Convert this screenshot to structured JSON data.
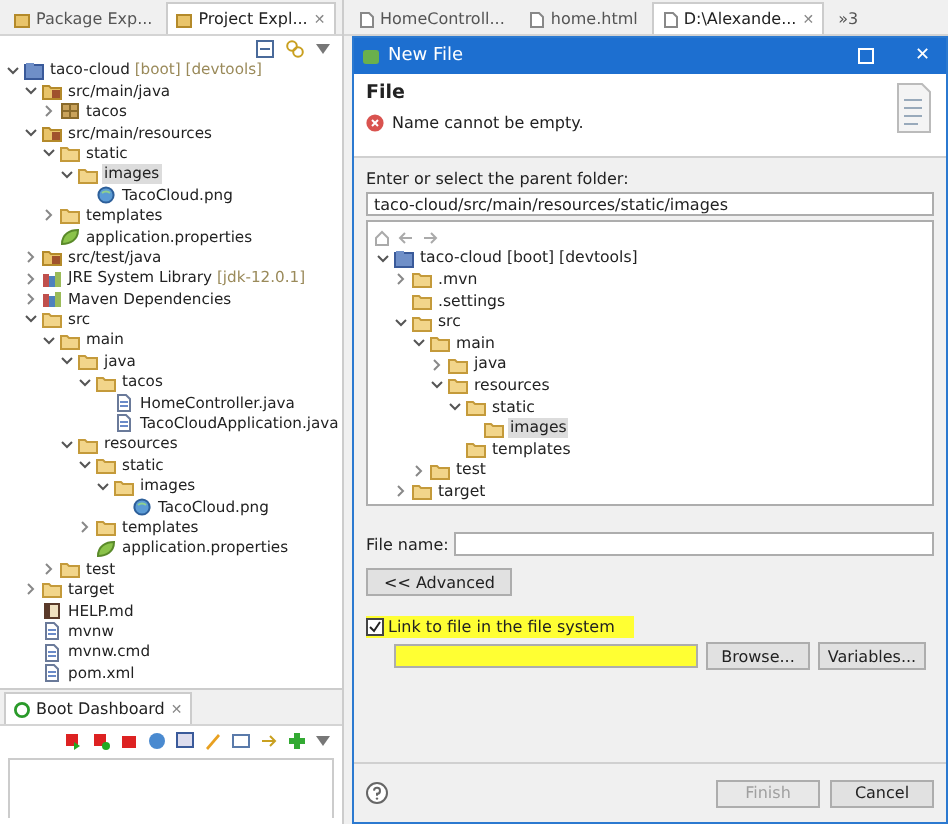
{
  "explorer": {
    "tabs": [
      {
        "label": "Package Exp...",
        "selected": false
      },
      {
        "label": "Project Expl...",
        "selected": true,
        "close": "✕"
      }
    ],
    "tree": [
      {
        "label": "taco-cloud",
        "decoration": "[boot] [devtools]",
        "kind": "project",
        "expanded": true,
        "selected": false,
        "children": [
          {
            "label": "src/main/java",
            "kind": "source",
            "expanded": true,
            "selected": false,
            "children": [
              {
                "label": "tacos",
                "kind": "package",
                "expanded": false,
                "selected": false
              }
            ]
          },
          {
            "label": "src/main/resources",
            "kind": "source",
            "expanded": true,
            "selected": false,
            "children": [
              {
                "label": "static",
                "kind": "folder",
                "expanded": true,
                "selected": false,
                "children": [
                  {
                    "label": "images",
                    "kind": "folder",
                    "expanded": true,
                    "selected": true,
                    "children": [
                      {
                        "label": "TacoCloud.png",
                        "kind": "image",
                        "selected": false
                      }
                    ]
                  }
                ]
              },
              {
                "label": "templates",
                "kind": "folder",
                "expanded": false,
                "selected": false
              },
              {
                "label": "application.properties",
                "kind": "leaf",
                "selected": false
              }
            ]
          },
          {
            "label": "src/test/java",
            "kind": "source",
            "expanded": false,
            "selected": false
          },
          {
            "label": "JRE System Library",
            "decoration": "[jdk-12.0.1]",
            "kind": "library",
            "expanded": false,
            "selected": false
          },
          {
            "label": "Maven Dependencies",
            "kind": "library",
            "expanded": false,
            "selected": false
          },
          {
            "label": "src",
            "kind": "folder",
            "expanded": true,
            "selected": false,
            "children": [
              {
                "label": "main",
                "kind": "folder",
                "expanded": true,
                "selected": false,
                "children": [
                  {
                    "label": "java",
                    "kind": "folder",
                    "expanded": true,
                    "selected": false,
                    "children": [
                      {
                        "label": "tacos",
                        "kind": "folder",
                        "expanded": true,
                        "selected": false,
                        "children": [
                          {
                            "label": "HomeController.java",
                            "kind": "file",
                            "selected": false
                          },
                          {
                            "label": "TacoCloudApplication.java",
                            "kind": "file",
                            "selected": false
                          }
                        ]
                      }
                    ]
                  },
                  {
                    "label": "resources",
                    "kind": "folder",
                    "expanded": true,
                    "selected": false,
                    "children": [
                      {
                        "label": "static",
                        "kind": "folder",
                        "expanded": true,
                        "selected": false,
                        "children": [
                          {
                            "label": "images",
                            "kind": "folder",
                            "expanded": true,
                            "selected": false,
                            "children": [
                              {
                                "label": "TacoCloud.png",
                                "kind": "image",
                                "selected": false
                              }
                            ]
                          }
                        ]
                      },
                      {
                        "label": "templates",
                        "kind": "folder",
                        "expanded": false,
                        "selected": false
                      },
                      {
                        "label": "application.properties",
                        "kind": "leaf",
                        "selected": false
                      }
                    ]
                  }
                ]
              },
              {
                "label": "test",
                "kind": "folder",
                "expanded": false,
                "selected": false
              }
            ]
          },
          {
            "label": "target",
            "kind": "folder",
            "expanded": false,
            "selected": false
          },
          {
            "label": "HELP.md",
            "kind": "book",
            "selected": false
          },
          {
            "label": "mvnw",
            "kind": "file",
            "selected": false
          },
          {
            "label": "mvnw.cmd",
            "kind": "file",
            "selected": false
          },
          {
            "label": "pom.xml",
            "kind": "file",
            "selected": false
          }
        ]
      }
    ]
  },
  "boot_dashboard": {
    "title": "Boot Dashboard",
    "close": "✕"
  },
  "editor_tabs": [
    {
      "label": "HomeControll...",
      "selected": false
    },
    {
      "label": "home.html",
      "selected": false
    },
    {
      "label": "D:\\Alexande...",
      "selected": true,
      "close": "✕"
    }
  ],
  "editor_overflow": "»3",
  "dialog": {
    "title": "New File",
    "close": "✕",
    "heading": "File",
    "error": "Name cannot be empty.",
    "folder_label": "Enter or select the parent folder:",
    "folder_value": "taco-cloud/src/main/resources/static/images",
    "tree": [
      {
        "label": "taco-cloud [boot] [devtools]",
        "kind": "project",
        "expanded": true,
        "selected": false,
        "children": [
          {
            "label": ".mvn",
            "kind": "folder",
            "expanded": false,
            "selected": false
          },
          {
            "label": ".settings",
            "kind": "folder",
            "selected": false
          },
          {
            "label": "src",
            "kind": "folder",
            "expanded": true,
            "selected": false,
            "children": [
              {
                "label": "main",
                "kind": "folder",
                "expanded": true,
                "selected": false,
                "children": [
                  {
                    "label": "java",
                    "kind": "folder",
                    "expanded": false,
                    "selected": false
                  },
                  {
                    "label": "resources",
                    "kind": "folder",
                    "expanded": true,
                    "selected": false,
                    "children": [
                      {
                        "label": "static",
                        "kind": "folder",
                        "expanded": true,
                        "selected": false,
                        "children": [
                          {
                            "label": "images",
                            "kind": "folder",
                            "selected": true
                          }
                        ]
                      },
                      {
                        "label": "templates",
                        "kind": "folder",
                        "selected": false
                      }
                    ]
                  }
                ]
              },
              {
                "label": "test",
                "kind": "folder",
                "expanded": false,
                "selected": false
              }
            ]
          },
          {
            "label": "target",
            "kind": "folder",
            "expanded": false,
            "selected": false
          }
        ]
      }
    ],
    "file_name_label": "File name:",
    "advanced_button": "<< Advanced",
    "link": {
      "label": "Link to file in the file system",
      "checked": true,
      "highlighted": true
    },
    "browse_button": "Browse...",
    "variables_button": "Variables...",
    "finish": {
      "label": "Finish",
      "disabled": true
    },
    "cancel_button": "Cancel"
  }
}
